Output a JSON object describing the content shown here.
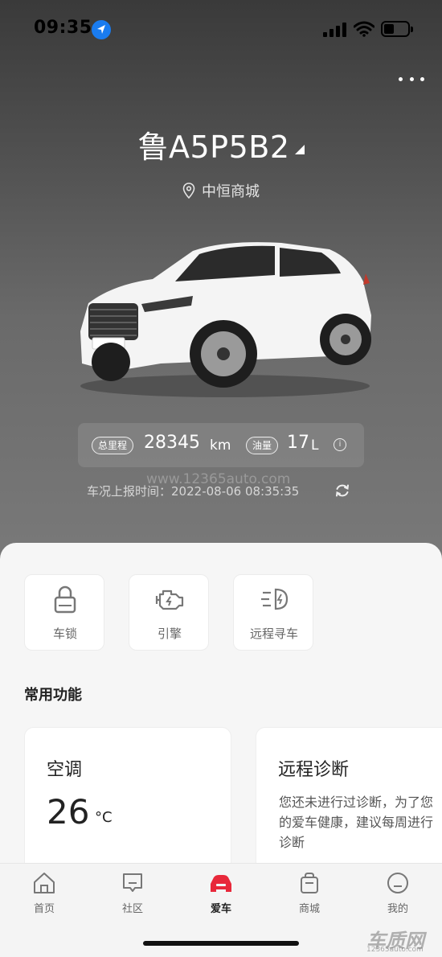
{
  "status_bar": {
    "time": "09:35"
  },
  "vehicle": {
    "plate": "鲁A5P5B2",
    "location": "中恒商城",
    "mileage_tag": "总里程",
    "mileage_value": "28345",
    "mileage_unit": "km",
    "fuel_tag": "油量",
    "fuel_value": "17",
    "fuel_unit": "L",
    "report_label": "车况上报时间：",
    "report_time": "2022-08-06 08:35:35"
  },
  "watermark": {
    "url": "www.12365auto.com",
    "logo": "车质网",
    "logo_url": "12365auto.com"
  },
  "quick_actions": [
    {
      "label": "车锁",
      "icon": "lock-icon"
    },
    {
      "label": "引擎",
      "icon": "engine-icon"
    },
    {
      "label": "远程寻车",
      "icon": "headlight-icon"
    }
  ],
  "features": {
    "title": "常用功能",
    "ac": {
      "title": "空调",
      "temperature": "26",
      "unit": "°C"
    },
    "diagnosis": {
      "title": "远程诊断",
      "text": "您还未进行过诊断，为了您的爱车健康，建议每周进行诊断"
    }
  },
  "tabs": [
    {
      "label": "首页",
      "icon": "home-icon"
    },
    {
      "label": "社区",
      "icon": "community-icon"
    },
    {
      "label": "爱车",
      "icon": "car-icon",
      "active": true
    },
    {
      "label": "商城",
      "icon": "shop-icon"
    },
    {
      "label": "我的",
      "icon": "profile-icon"
    }
  ],
  "colors": {
    "accent": "#e8283a",
    "ios_blue": "#1a7cf0"
  }
}
